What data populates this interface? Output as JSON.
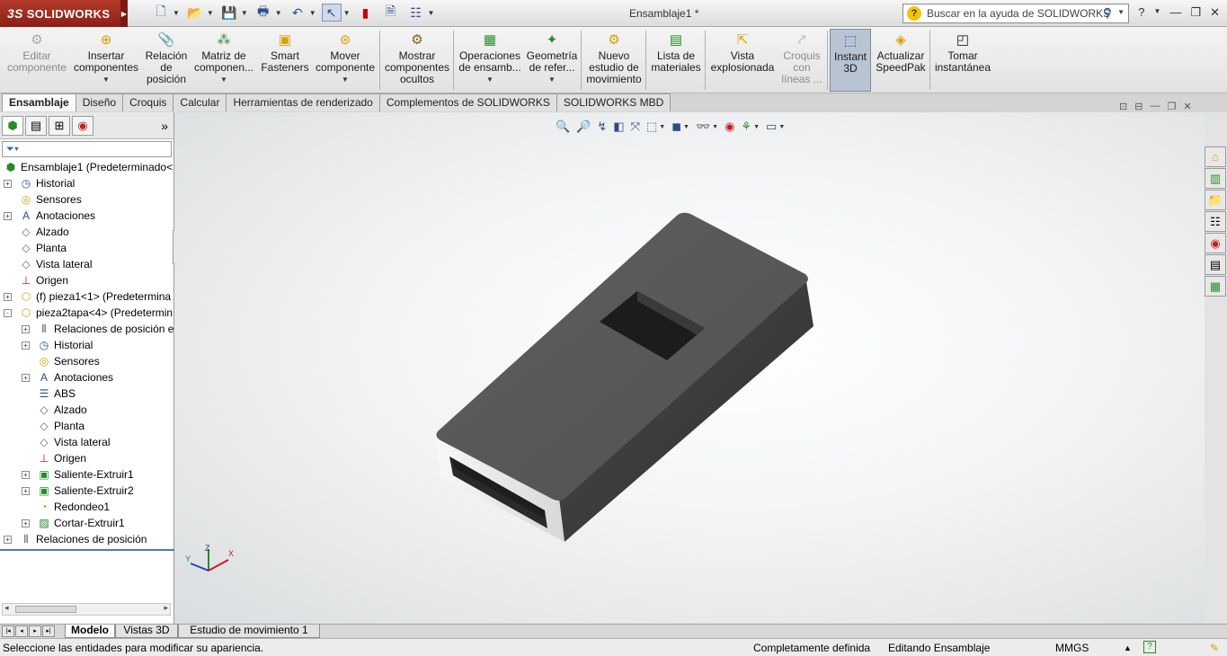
{
  "titlebar": {
    "logo": "SOLIDWORKS",
    "document_title": "Ensamblaje1 *",
    "search_placeholder": "Buscar en la ayuda de SOLIDWORKS",
    "icons": [
      "new-icon",
      "open-icon",
      "save-icon",
      "print-icon",
      "undo-icon",
      "select-icon",
      "rebuild-icon",
      "file-properties-icon",
      "options-icon"
    ]
  },
  "commands": [
    {
      "label": "Editar componente",
      "lines": [
        "Editar",
        "componente"
      ],
      "disabled": true
    },
    {
      "label": "Insertar componentes",
      "lines": [
        "Insertar",
        "componentes"
      ],
      "caret": true
    },
    {
      "label": "Relación de posición",
      "lines": [
        "Relación",
        "de",
        "posición"
      ]
    },
    {
      "label": "Matriz de componen...",
      "lines": [
        "Matriz de",
        "componen..."
      ],
      "caret": true
    },
    {
      "label": "Smart Fasteners",
      "lines": [
        "Smart",
        "Fasteners"
      ]
    },
    {
      "label": "Mover componente",
      "lines": [
        "Mover",
        "componente"
      ],
      "caret": true
    },
    {
      "label": "Mostrar componentes ocultos",
      "lines": [
        "Mostrar",
        "componentes",
        "ocultos"
      ]
    },
    {
      "label": "Operaciones de ensamb...",
      "lines": [
        "Operaciones",
        "de ensamb..."
      ],
      "caret": true
    },
    {
      "label": "Geometría de refer...",
      "lines": [
        "Geometría",
        "de refer..."
      ],
      "caret": true
    },
    {
      "label": "Nuevo estudio de movimiento",
      "lines": [
        "Nuevo",
        "estudio de",
        "movimiento"
      ]
    },
    {
      "label": "Lista de materiales",
      "lines": [
        "Lista de",
        "materiales"
      ]
    },
    {
      "label": "Vista explosionada",
      "lines": [
        "Vista",
        "explosionada"
      ]
    },
    {
      "label": "Croquis con líneas ...",
      "lines": [
        "Croquis",
        "con",
        "líneas ..."
      ],
      "disabled": true
    },
    {
      "label": "Instant 3D",
      "lines": [
        "Instant",
        "3D"
      ],
      "active": true
    },
    {
      "label": "Actualizar SpeedPak",
      "lines": [
        "Actualizar",
        "SpeedPak"
      ]
    },
    {
      "label": "Tomar instantánea",
      "lines": [
        "Tomar",
        "instantánea"
      ]
    }
  ],
  "tabs": [
    "Ensamblaje",
    "Diseño",
    "Croquis",
    "Calcular",
    "Herramientas de renderizado",
    "Complementos de SOLIDWORKS",
    "SOLIDWORKS MBD"
  ],
  "active_tab": "Ensamblaje",
  "tree": [
    {
      "label": "Ensamblaje1  (Predeterminado<",
      "level": 0,
      "expander": "",
      "icon": "assembly-icon"
    },
    {
      "label": "Historial",
      "level": 1,
      "expander": "+",
      "icon": "history-icon"
    },
    {
      "label": "Sensores",
      "level": 1,
      "expander": "",
      "icon": "sensor-icon"
    },
    {
      "label": "Anotaciones",
      "level": 1,
      "expander": "+",
      "icon": "annotations-icon"
    },
    {
      "label": "Alzado",
      "level": 1,
      "expander": "",
      "icon": "plane-icon"
    },
    {
      "label": "Planta",
      "level": 1,
      "expander": "",
      "icon": "plane-icon"
    },
    {
      "label": "Vista lateral",
      "level": 1,
      "expander": "",
      "icon": "plane-icon"
    },
    {
      "label": "Origen",
      "level": 1,
      "expander": "",
      "icon": "origin-icon"
    },
    {
      "label": "(f) pieza1<1> (Predetermina",
      "level": 1,
      "expander": "+",
      "icon": "part-icon"
    },
    {
      "label": "pieza2tapa<4> (Predetermin",
      "level": 1,
      "expander": "-",
      "icon": "part-icon"
    },
    {
      "label": "Relaciones de posición e",
      "level": 2,
      "expander": "+",
      "icon": "mates-icon"
    },
    {
      "label": "Historial",
      "level": 2,
      "expander": "+",
      "icon": "history-icon"
    },
    {
      "label": "Sensores",
      "level": 2,
      "expander": "",
      "icon": "sensor-icon"
    },
    {
      "label": "Anotaciones",
      "level": 2,
      "expander": "+",
      "icon": "annotations-icon"
    },
    {
      "label": "ABS",
      "level": 2,
      "expander": "",
      "icon": "material-icon"
    },
    {
      "label": "Alzado",
      "level": 2,
      "expander": "",
      "icon": "plane-icon"
    },
    {
      "label": "Planta",
      "level": 2,
      "expander": "",
      "icon": "plane-icon"
    },
    {
      "label": "Vista lateral",
      "level": 2,
      "expander": "",
      "icon": "plane-icon"
    },
    {
      "label": "Origen",
      "level": 2,
      "expander": "",
      "icon": "origin-icon"
    },
    {
      "label": "Saliente-Extruir1",
      "level": 2,
      "expander": "+",
      "icon": "extrude-icon"
    },
    {
      "label": "Saliente-Extruir2",
      "level": 2,
      "expander": "+",
      "icon": "extrude-icon"
    },
    {
      "label": "Redondeo1",
      "level": 2,
      "expander": "",
      "icon": "fillet-icon"
    },
    {
      "label": "Cortar-Extruir1",
      "level": 2,
      "expander": "+",
      "icon": "cut-extrude-icon"
    },
    {
      "label": "Relaciones de posición",
      "level": 1,
      "expander": "+",
      "icon": "mates-icon"
    }
  ],
  "bottom_tabs": [
    "Modelo",
    "Vistas 3D",
    "Estudio de movimiento 1"
  ],
  "active_bottom_tab": "Modelo",
  "status": {
    "message": "Seleccione las entidades para modificar su apariencia.",
    "definition": "Completamente definida",
    "mode": "Editando Ensamblaje",
    "units": "MMGS"
  },
  "colors": {
    "brand": "#a62e22",
    "model_top": "#585858",
    "model_side": "#3c3c3c",
    "model_end": "#f2f2f2"
  }
}
